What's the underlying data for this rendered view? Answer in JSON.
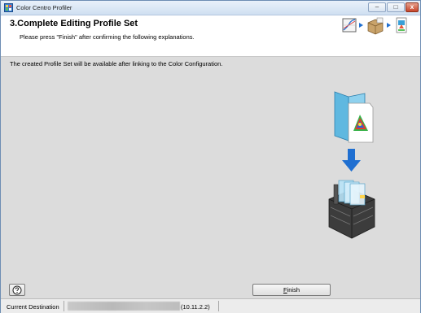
{
  "window": {
    "title": "Color Centro Profiler",
    "controls": {
      "minimize": "–",
      "maximize": "□",
      "close": "x"
    }
  },
  "header": {
    "title": "3.Complete Editing Profile Set",
    "subtitle": "Please press \"Finish\" after confirming the following explanations.",
    "steps": [
      "graph-icon",
      "package-icon",
      "document-icon"
    ]
  },
  "main": {
    "info": "The created Profile Set will be available after linking to the Color Configuration.",
    "illustration": [
      "profile-folder-icon",
      "down-arrow-icon",
      "printer-server-icon"
    ]
  },
  "footer": {
    "help_icon": "help-icon",
    "finish_prefix": "",
    "finish_underlined": "F",
    "finish_rest": "inish"
  },
  "statusbar": {
    "label": "Current Destination",
    "address_suffix": "(10.11.2.2)"
  },
  "colors": {
    "accent_blue": "#1f6fd1",
    "title_bar": "#dbe7f4",
    "body": "#dcdcdc"
  }
}
